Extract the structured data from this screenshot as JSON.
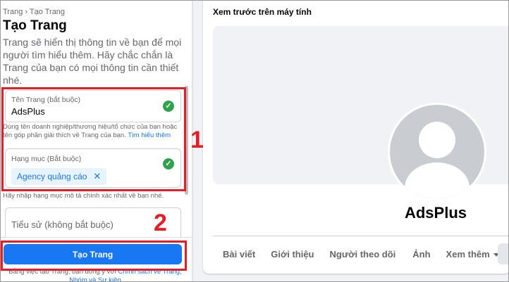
{
  "form": {
    "breadcrumb": "Trang › Tạo Trang",
    "title": "Tạo Trang",
    "description": "Trang sẽ hiển thị thông tin về bạn để mọi người tìm hiểu thêm. Hãy chắc chắn là Trang của bạn có mọi thông tin cần thiết nhé.",
    "page_name": {
      "label": "Tên Trang (bắt buộc)",
      "value": "AdsPlus",
      "help": "Dùng tên doanh nghiệp/thương hiệu/tổ chức của bạn hoặc tên góp phần giải thích về Trang của bạn.",
      "help_link": "Tìm hiểu thêm"
    },
    "category": {
      "label": "Hạng mục (Bắt buộc)",
      "chip": "Agency quảng cáo",
      "help": "Hãy nhập hạng mục mô tả chính xác nhất về bạn nhé."
    },
    "bio": {
      "placeholder": "Tiểu sử (không bắt buộc)"
    },
    "create_button": "Tạo Trang",
    "terms_prefix": "Bằng việc tạo Trang, bạn đồng ý với ",
    "terms_link": "Chính sách về Trang, Nhóm và Sự kiện"
  },
  "annotations": {
    "step1": "1",
    "step2": "2"
  },
  "preview": {
    "title": "Xem trước trên máy tính",
    "page_name": "AdsPlus",
    "tabs": [
      "Bài viết",
      "Giới thiệu",
      "Người theo dõi",
      "Ảnh",
      "Xem thêm"
    ]
  },
  "colors": {
    "primary": "#1877f2",
    "success": "#31a24c",
    "annotation": "#e41e26"
  },
  "icons": {
    "valid": "check-circle-icon",
    "remove": "close-icon",
    "more": "caret-down-icon",
    "avatar": "default-avatar-icon"
  }
}
